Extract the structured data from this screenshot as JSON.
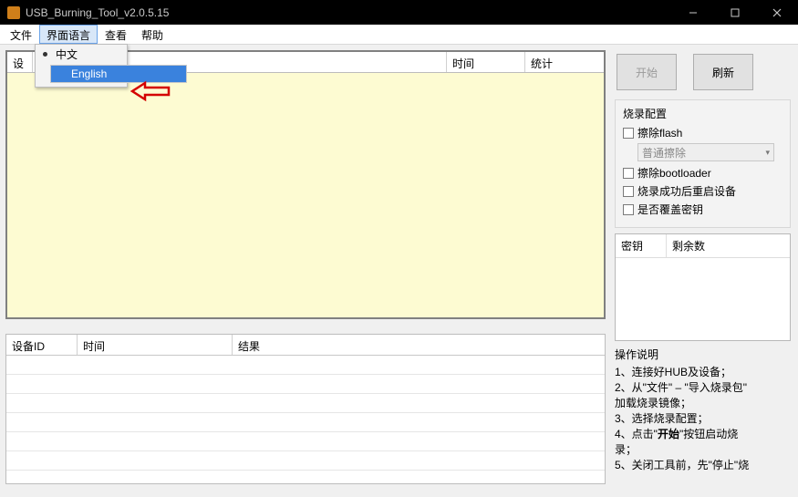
{
  "title": "USB_Burning_Tool_v2.0.5.15",
  "menu": {
    "file": "文件",
    "lang": "界面语言",
    "view": "查看",
    "help": "帮助"
  },
  "dropdown": {
    "chinese": "中文",
    "english": "English"
  },
  "headers": {
    "device_short": "设",
    "time": "时间",
    "stat": "统计"
  },
  "headers2": {
    "deviceId": "设备ID",
    "time": "时间",
    "result": "结果"
  },
  "buttons": {
    "start": "开始",
    "refresh": "刷新"
  },
  "config": {
    "title": "烧录配置",
    "erase_flash": "擦除flash",
    "erase_mode": "普通擦除",
    "erase_boot": "擦除bootloader",
    "reboot": "烧录成功后重启设备",
    "override_key": "是否覆盖密钥"
  },
  "key_table": {
    "key": "密钥",
    "remain": "剩余数"
  },
  "instructions": {
    "title": "操作说明",
    "s1a": "1、连接好HUB及设备；",
    "s2a": "2、从\"文件\" – \"导入烧录包\"",
    "s2b": "加载烧录镜像；",
    "s3a": "3、选择烧录配置；",
    "s4a": "4、点击\"",
    "s4b": "开始",
    "s4c": "\"按钮启动烧",
    "s4d": "录；",
    "s5a": "5、关闭工具前，先\"停止\"烧"
  }
}
